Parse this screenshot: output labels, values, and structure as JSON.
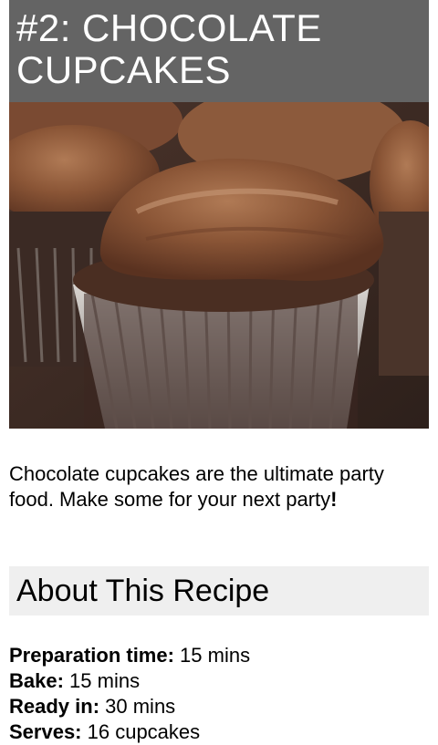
{
  "recipe": {
    "title": "#2: CHOCOLATE CUPCAKES",
    "image_description_icon": "cupcake-photo",
    "intro": "Chocolate cupcakes are the ultimate party food. Make some for your next party",
    "intro_end": "!"
  },
  "about": {
    "heading": "About This Recipe",
    "details": [
      {
        "label": "Preparation time:",
        "value": " 15 mins"
      },
      {
        "label": "Bake:",
        "value": " 15 mins"
      },
      {
        "label": "Ready in:",
        "value": " 30 mins"
      },
      {
        "label": "Serves:",
        "value": " 16 cupcakes"
      }
    ]
  },
  "colors": {
    "title_bar": "#646464",
    "section_head": "#efefef"
  }
}
